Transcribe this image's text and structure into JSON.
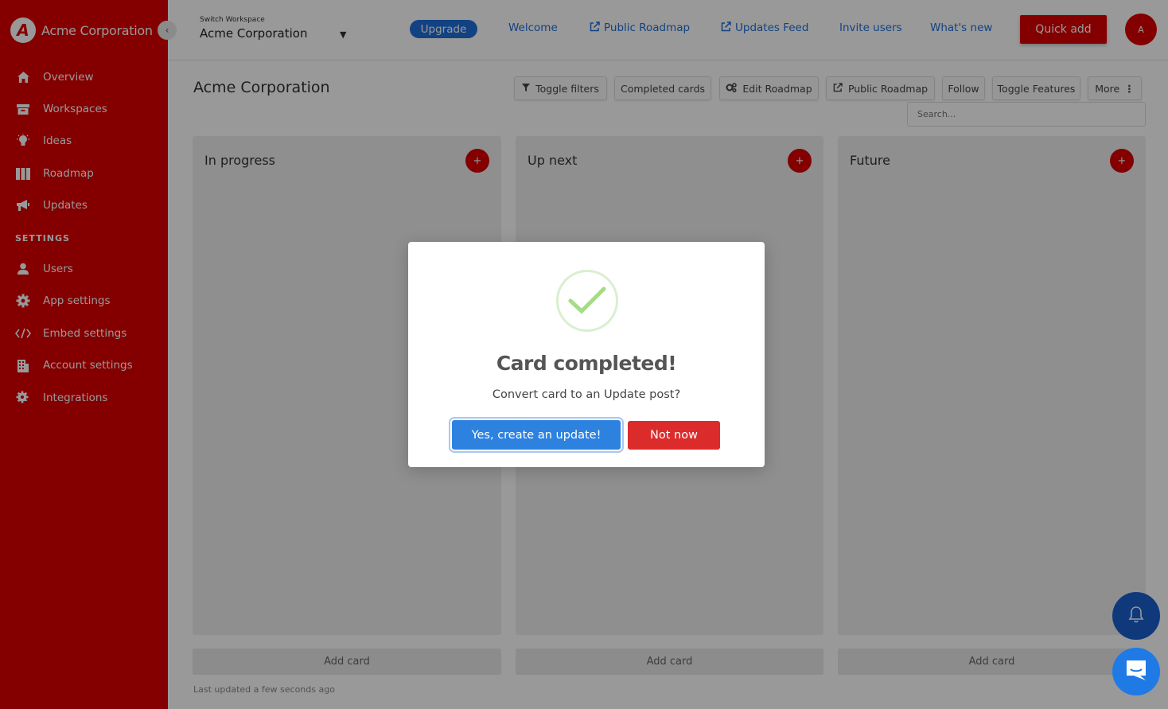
{
  "sidebar": {
    "brand_logo_letter": "A",
    "brand_name": "Acme Corporation",
    "items": [
      {
        "label": "Overview",
        "icon": "home-icon"
      },
      {
        "label": "Workspaces",
        "icon": "archive-icon"
      },
      {
        "label": "Ideas",
        "icon": "lightbulb-icon"
      },
      {
        "label": "Roadmap",
        "icon": "columns-icon"
      },
      {
        "label": "Updates",
        "icon": "megaphone-icon"
      }
    ],
    "settings_header": "SETTINGS",
    "settings_items": [
      {
        "label": "Users",
        "icon": "user-icon"
      },
      {
        "label": "App settings",
        "icon": "gear-icon"
      },
      {
        "label": "Embed settings",
        "icon": "code-icon"
      },
      {
        "label": "Account settings",
        "icon": "building-icon"
      },
      {
        "label": "Integrations",
        "icon": "api-gear-icon"
      }
    ]
  },
  "topbar": {
    "workspace_label": "Switch Workspace",
    "workspace_name": "Acme Corporation",
    "upgrade": "Upgrade",
    "links": [
      "Welcome",
      "Public Roadmap",
      "Updates Feed",
      "Invite users",
      "What's new"
    ],
    "quick_add": "Quick add",
    "avatar_initial": "A"
  },
  "content": {
    "title": "Acme Corporation",
    "toolbar": [
      "Toggle filters",
      "Completed cards",
      "Edit Roadmap",
      "Public Roadmap",
      "Follow",
      "Toggle Features",
      "More"
    ],
    "search_placeholder": "Search...",
    "columns": [
      {
        "title": "In progress",
        "add_card": "Add card"
      },
      {
        "title": "Up next",
        "add_card": "Add card"
      },
      {
        "title": "Future",
        "add_card": "Add card"
      }
    ],
    "last_updated": "Last updated a few seconds ago"
  },
  "modal": {
    "title": "Card completed!",
    "message": "Convert card to an Update post?",
    "confirm": "Yes, create an update!",
    "cancel": "Not now"
  },
  "colors": {
    "brand_red": "#dc0000",
    "link_blue": "#1e6fd9",
    "confirm_blue": "#2d82e0",
    "cancel_red": "#dc2b2b",
    "check_green": "#a5dc86"
  }
}
